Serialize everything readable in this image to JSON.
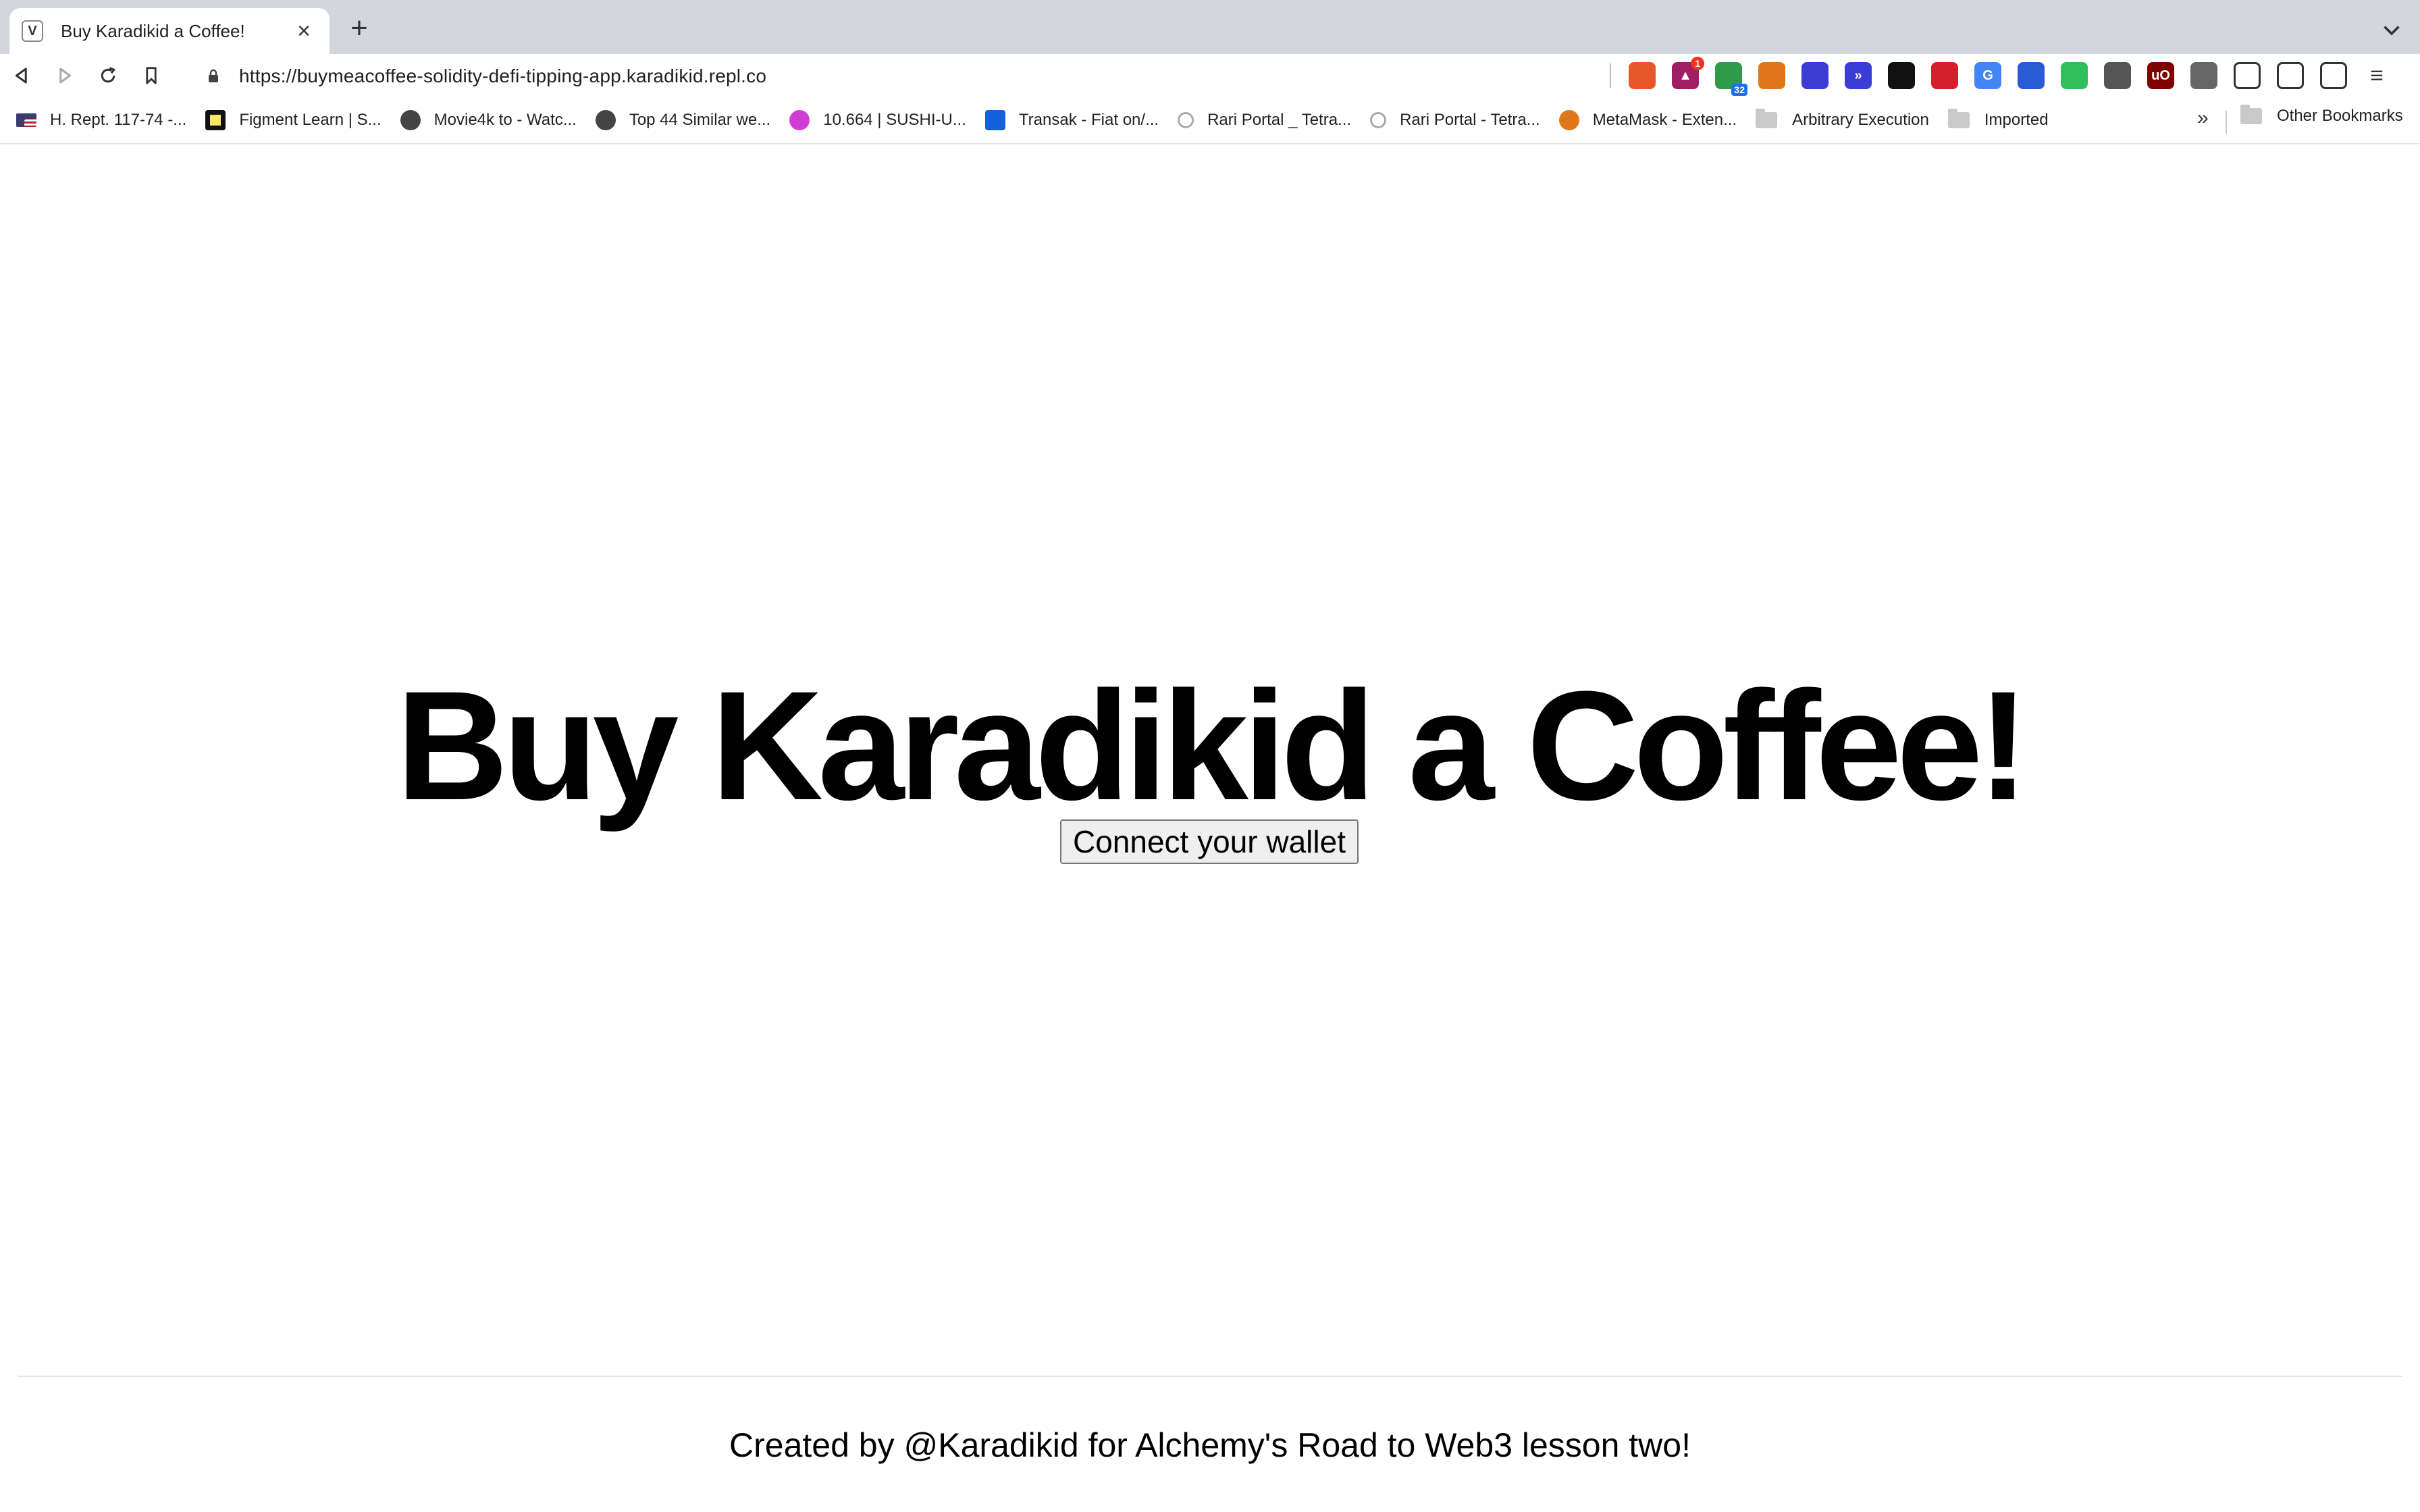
{
  "browser": {
    "tab": {
      "favicon_text": "V",
      "title": "Buy Karadikid a Coffee!"
    },
    "url": "https://buymeacoffee-solidity-defi-tipping-app.karadikid.repl.co",
    "extensions": [
      {
        "name": "brave-shield-icon",
        "color": "#e8572a",
        "text": "",
        "badge": ""
      },
      {
        "name": "brave-rewards-icon",
        "color": "#9e1f63",
        "text": "▲",
        "badge": "1"
      },
      {
        "name": "tab-counter-icon",
        "color": "#2e9a4a",
        "text": "",
        "badge_bottom": "32"
      },
      {
        "name": "metamask-icon",
        "color": "#e2761b",
        "text": "",
        "badge": ""
      },
      {
        "name": "extension-circle-icon",
        "color": "#3b3bd6",
        "text": "",
        "badge": ""
      },
      {
        "name": "extension-chevrons-icon",
        "color": "#3b3bd6",
        "text": "»",
        "badge": ""
      },
      {
        "name": "extension-dark-icon",
        "color": "#111111",
        "text": "",
        "badge": ""
      },
      {
        "name": "extension-red-icon",
        "color": "#d61f2c",
        "text": "",
        "badge": ""
      },
      {
        "name": "google-translate-icon",
        "color": "#4285f4",
        "text": "G",
        "badge": ""
      },
      {
        "name": "extension-bird-icon",
        "color": "#2a5bd7",
        "text": "",
        "badge": ""
      },
      {
        "name": "extension-green-icon",
        "color": "#2fbf5b",
        "text": "",
        "badge": ""
      },
      {
        "name": "extension-cube-icon",
        "color": "#555555",
        "text": "",
        "badge": ""
      },
      {
        "name": "ublock-icon",
        "color": "#800000",
        "text": "uO",
        "badge": ""
      },
      {
        "name": "extension-gear-icon",
        "color": "#666666",
        "text": "",
        "badge": ""
      },
      {
        "name": "extensions-puzzle-icon",
        "color": "#333333",
        "text": "",
        "badge": ""
      },
      {
        "name": "sidebar-icon",
        "color": "#333333",
        "text": "",
        "badge": ""
      },
      {
        "name": "wallet-icon",
        "color": "#333333",
        "text": "",
        "badge": ""
      },
      {
        "name": "menu-icon",
        "color": "#333333",
        "text": "≡",
        "badge": ""
      }
    ],
    "bookmarks": [
      {
        "label": "H. Rept. 117-74 -...",
        "icon": "us-flag-icon",
        "color": "#b22234"
      },
      {
        "label": "Figment Learn | S...",
        "icon": "figment-icon",
        "color": "#f5e663"
      },
      {
        "label": "Movie4k to - Watc...",
        "icon": "globe-icon",
        "color": "#444444"
      },
      {
        "label": "Top 44 Similar we...",
        "icon": "globe-icon",
        "color": "#444444"
      },
      {
        "label": "10.664 | SUSHI-U...",
        "icon": "sushi-icon",
        "color": "#d23cd6"
      },
      {
        "label": "Transak - Fiat on/...",
        "icon": "transak-icon",
        "color": "#1461db"
      },
      {
        "label": "Rari Portal _ Tetra...",
        "icon": "rari-icon",
        "color": "#aaaaaa"
      },
      {
        "label": "Rari Portal - Tetra...",
        "icon": "rari-icon",
        "color": "#aaaaaa"
      },
      {
        "label": "MetaMask - Exten...",
        "icon": "metamask-icon",
        "color": "#e2761b"
      },
      {
        "label": "Arbitrary Execution",
        "icon": "folder-icon",
        "color": "#c9c9c9"
      },
      {
        "label": "Imported",
        "icon": "folder-icon",
        "color": "#c9c9c9"
      }
    ],
    "bookmarks_more": "»",
    "other_bookmarks": "Other Bookmarks"
  },
  "page": {
    "title": "Buy Karadikid a Coffee!",
    "connect_button": "Connect your wallet",
    "footer": "Created by @Karadikid for Alchemy's Road to Web3 lesson two!"
  }
}
